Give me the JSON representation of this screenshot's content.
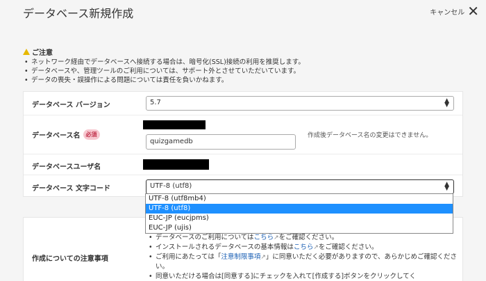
{
  "header": {
    "title": "データベース新規作成",
    "cancel_label": "キャンセル"
  },
  "notice": {
    "heading": "ご注意",
    "items": [
      "ネットワーク経由でデータベースへ接続する場合は、暗号化(SSL)接続の利用を推奨します。",
      "データベースや、管理ツールのご利用については、サポート外とさせていただいています。",
      "データの喪失・誤操作による問題については責任を負いかねます。"
    ]
  },
  "form": {
    "version_label": "データベース バージョン",
    "version_value": "5.7",
    "name_label": "データベース名",
    "required_badge": "必須",
    "name_value": "quizgamedb",
    "name_hint": "作成後データベース名の変更はできません。",
    "user_label": "データベースユーザ名",
    "charset_label": "データベース 文字コード",
    "charset_value": "UTF-8 (utf8)",
    "charset_options": [
      "UTF-8 (utf8mb4)",
      "UTF-8 (utf8)",
      "EUC-JP (eucjpms)",
      "EUC-JP (ujis)"
    ],
    "charset_selected_index": 1
  },
  "notes": {
    "label": "作成についての注意事項",
    "items": [
      {
        "pre": "データベースのご利用については",
        "link": "こちら",
        "post": "をご確認ください。"
      },
      {
        "pre": "インストールされるデータベースの基本情報は",
        "link": "こちら",
        "post": "をご確認ください。"
      },
      {
        "pre": "ご利用にあたっては「",
        "link": "注意制限事項",
        "post": "」に同意いただく必要がありますので、あらかじめご確認ください。"
      },
      {
        "pre": "同意いただける場合は[同意する]にチェックを入れて[作成する]ボタンをクリックしてく",
        "link": "",
        "post": ""
      }
    ]
  },
  "icons": {
    "warning": "warning-icon",
    "close": "close-icon",
    "external": "external-link-icon",
    "select_arrows": "sort-arrows-icon"
  },
  "colors": {
    "accent": "#1e90ff",
    "required_bg": "#f7c7cf",
    "warning": "#e6b800",
    "link": "#1a5fb4"
  }
}
